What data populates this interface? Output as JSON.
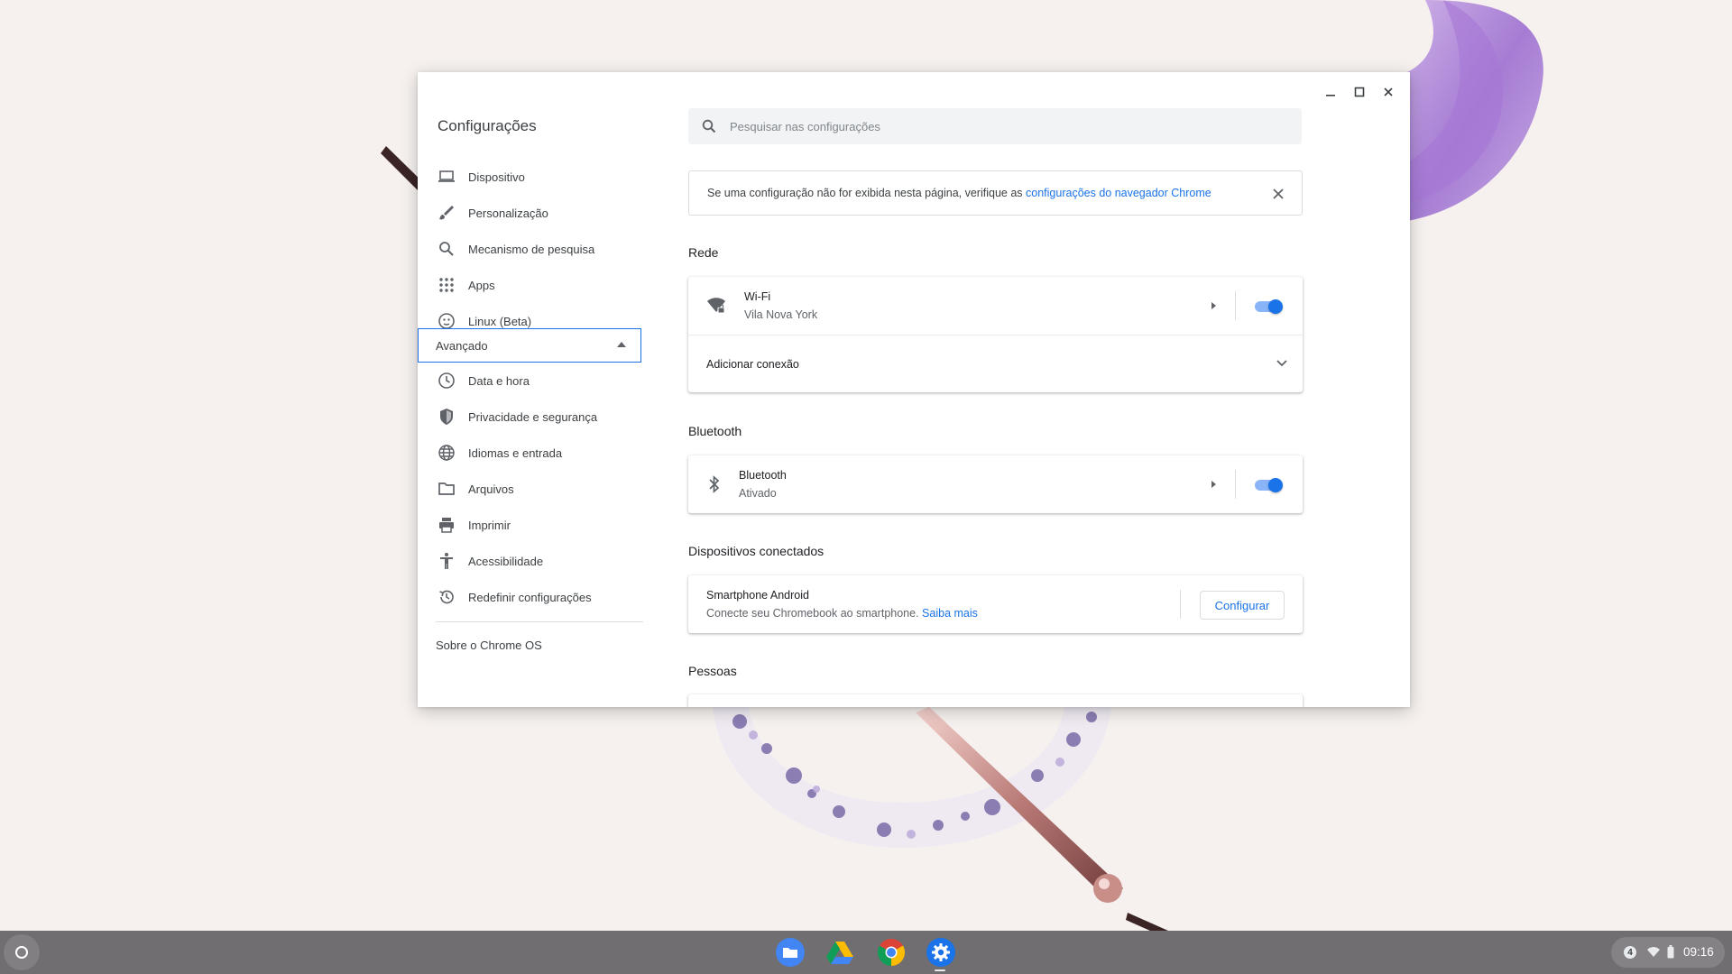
{
  "window": {
    "app_title": "Configurações",
    "controls": {
      "minimize": "minimize-icon",
      "maximize": "maximize-icon",
      "close": "close-icon"
    }
  },
  "sidebar": {
    "items": [
      {
        "label": "Dispositivo",
        "icon": "laptop-icon"
      },
      {
        "label": "Personalização",
        "icon": "brush-icon"
      },
      {
        "label": "Mecanismo de pesquisa",
        "icon": "search-icon"
      },
      {
        "label": "Apps",
        "icon": "apps-grid-icon"
      },
      {
        "label": "Linux (Beta)",
        "icon": "linux-icon"
      }
    ],
    "advanced_label": "Avançado",
    "advanced_items": [
      {
        "label": "Data e hora",
        "icon": "clock-icon"
      },
      {
        "label": "Privacidade e segurança",
        "icon": "shield-icon"
      },
      {
        "label": "Idiomas e entrada",
        "icon": "globe-icon"
      },
      {
        "label": "Arquivos",
        "icon": "folder-icon"
      },
      {
        "label": "Imprimir",
        "icon": "printer-icon"
      },
      {
        "label": "Acessibilidade",
        "icon": "accessibility-icon"
      },
      {
        "label": "Redefinir configurações",
        "icon": "history-icon"
      }
    ],
    "about_label": "Sobre o Chrome OS"
  },
  "search": {
    "placeholder": "Pesquisar nas configurações",
    "value": ""
  },
  "notice": {
    "text": "Se uma configuração não for exibida nesta página, verifique as ",
    "link": "configurações do navegador Chrome"
  },
  "network": {
    "title": "Rede",
    "wifi_title": "Wi-Fi",
    "wifi_subtitle": "Vila Nova York",
    "wifi_enabled": true,
    "add_connection": "Adicionar conexão"
  },
  "bluetooth": {
    "title": "Bluetooth",
    "row_title": "Bluetooth",
    "row_subtitle": "Ativado",
    "enabled": true
  },
  "connected_devices": {
    "title": "Dispositivos conectados",
    "row_title": "Smartphone Android",
    "row_subtitle": "Conecte seu Chromebook ao smartphone.",
    "learn_more": "Saiba mais",
    "button": "Configurar"
  },
  "people": {
    "title": "Pessoas"
  },
  "shelf": {
    "apps": [
      "files-app-icon",
      "drive-app-icon",
      "chrome-app-icon",
      "settings-app-icon"
    ],
    "notification_count": "4",
    "time": "09:16"
  },
  "colors": {
    "accent": "#1a73e8",
    "toggle_track": "#8ab4f8"
  }
}
